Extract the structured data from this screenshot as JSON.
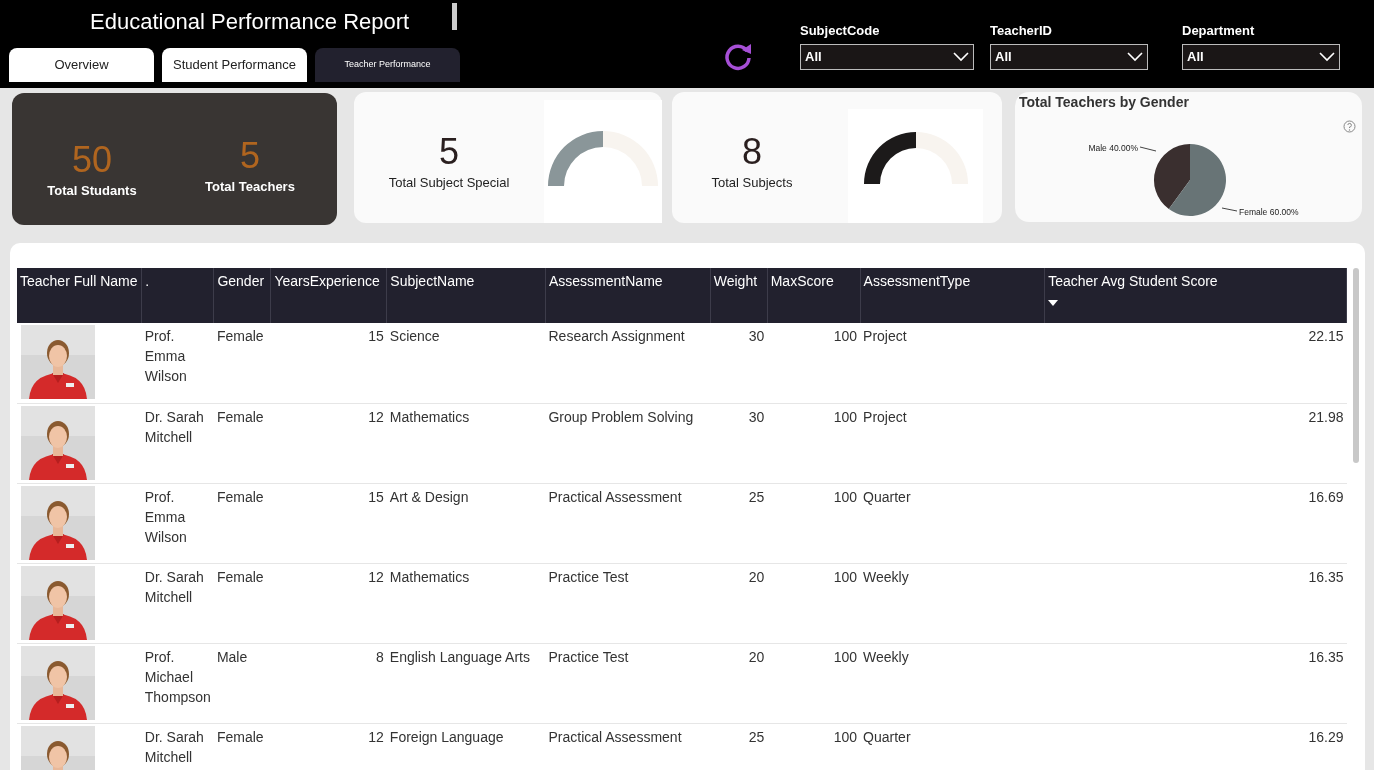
{
  "header": {
    "title": "Educational Performance Report"
  },
  "tabs": [
    {
      "label": "Overview",
      "selected": false
    },
    {
      "label": "Student Performance",
      "selected": false
    },
    {
      "label": "Teacher Performance",
      "selected": true
    }
  ],
  "filters": [
    {
      "label": "SubjectCode",
      "value": "All"
    },
    {
      "label": "TeacherID",
      "value": "All"
    },
    {
      "label": "Department",
      "value": "All"
    }
  ],
  "kpi_dark": [
    {
      "value": "50",
      "label": "Total Studants"
    },
    {
      "value": "5",
      "label": "Total Teachers"
    }
  ],
  "gauge_cards": [
    {
      "value": "5",
      "label": "Total Subject Special",
      "level": 0.5,
      "color": "#8a9699"
    },
    {
      "value": "8",
      "label": "Total Subjects",
      "level": 0.5,
      "color": "#1c1a1a"
    }
  ],
  "pie": {
    "title": "Total Teachers by Gender",
    "chart_data": {
      "type": "pie",
      "categories": [
        "Male 40.00%",
        "Female 60.00%"
      ],
      "series": [
        {
          "values": [
            40,
            60
          ]
        }
      ]
    }
  },
  "table": {
    "columns": [
      {
        "label": "Teacher Full Name",
        "sorted": false
      },
      {
        "label": ".",
        "sorted": false
      },
      {
        "label": "Gender",
        "sorted": false
      },
      {
        "label": "YearsExperience",
        "sorted": false
      },
      {
        "label": "SubjectName",
        "sorted": false
      },
      {
        "label": "AssessmentName",
        "sorted": false
      },
      {
        "label": "Weight",
        "sorted": false
      },
      {
        "label": "MaxScore",
        "sorted": false
      },
      {
        "label": "AssessmentType",
        "sorted": false
      },
      {
        "label": "Teacher Avg Student Score",
        "sorted": true
      }
    ],
    "rows": [
      {
        "cells": [
          "",
          "Prof. Emma Wilson",
          "Female",
          "15",
          "Science",
          "Research Assignment",
          "30",
          "100",
          "Project",
          "22.15"
        ]
      },
      {
        "cells": [
          "",
          "Dr. Sarah Mitchell",
          "Female",
          "12",
          "Mathematics",
          "Group Problem Solving",
          "30",
          "100",
          "Project",
          "21.98"
        ]
      },
      {
        "cells": [
          "",
          "Prof. Emma Wilson",
          "Female",
          "15",
          "Art & Design",
          "Practical Assessment",
          "25",
          "100",
          "Quarter",
          "16.69"
        ]
      },
      {
        "cells": [
          "",
          "Dr. Sarah Mitchell",
          "Female",
          "12",
          "Mathematics",
          "Practice Test",
          "20",
          "100",
          "Weekly",
          "16.35"
        ]
      },
      {
        "cells": [
          "",
          "Prof. Michael Thompson",
          "Male",
          "8",
          "English Language Arts",
          "Practice Test",
          "20",
          "100",
          "Weekly",
          "16.35"
        ]
      },
      {
        "cells": [
          "",
          "Dr. Sarah Mitchell",
          "Female",
          "12",
          "Foreign Language",
          "Practical Assessment",
          "25",
          "100",
          "Quarter",
          "16.29"
        ]
      }
    ]
  }
}
